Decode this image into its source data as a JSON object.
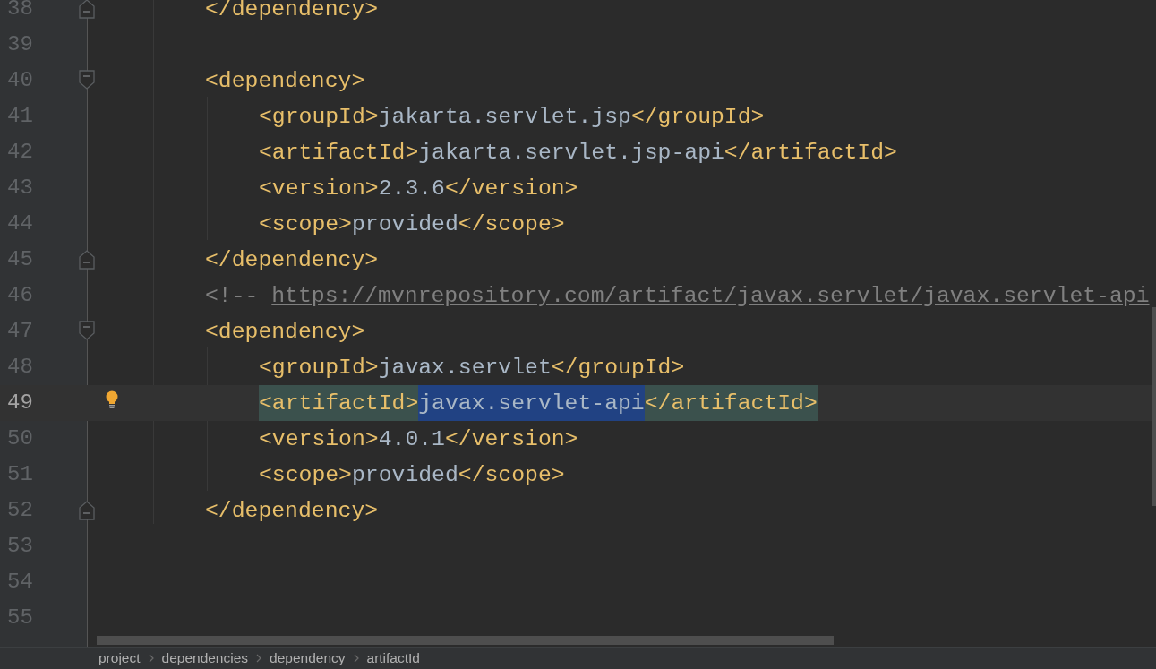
{
  "editor": {
    "lines": [
      {
        "number": "38",
        "current": false,
        "kind": "fold-end",
        "tokens": [
          {
            "kind": "tag",
            "text": "</dependency>"
          }
        ]
      },
      {
        "number": "39",
        "current": false
      },
      {
        "number": "40",
        "current": false,
        "kind": "fold-start",
        "tokens": [
          {
            "kind": "tag",
            "text": "<dependency>"
          }
        ],
        "children": [
          {
            "number": "41",
            "current": false,
            "tokens": [
              {
                "kind": "tag",
                "text": "<groupId>"
              },
              {
                "kind": "value",
                "text": "jakarta.servlet.jsp"
              },
              {
                "kind": "tag",
                "text": "</groupId>"
              }
            ]
          },
          {
            "number": "42",
            "current": false,
            "tokens": [
              {
                "kind": "tag",
                "text": "<artifactId>"
              },
              {
                "kind": "value",
                "text": "jakarta.servlet.jsp-api"
              },
              {
                "kind": "tag",
                "text": "</artifactId>"
              }
            ]
          },
          {
            "number": "43",
            "current": false,
            "tokens": [
              {
                "kind": "tag",
                "text": "<version>"
              },
              {
                "kind": "value",
                "text": "2.3.6"
              },
              {
                "kind": "tag",
                "text": "</version>"
              }
            ]
          },
          {
            "number": "44",
            "current": false,
            "tokens": [
              {
                "kind": "tag",
                "text": "<scope>"
              },
              {
                "kind": "value",
                "text": "provided"
              },
              {
                "kind": "tag",
                "text": "</scope>"
              }
            ]
          }
        ]
      },
      {
        "number": "45",
        "current": false,
        "kind": "fold-end",
        "tokens": [
          {
            "kind": "tag",
            "text": "</dependency>"
          }
        ]
      },
      {
        "number": "46",
        "current": false,
        "tokens": [
          {
            "kind": "comment",
            "text": "<!--"
          },
          {
            "kind": "link",
            "text": "https://mvnrepository.com/artifact/javax.servlet/javax.servlet-api"
          }
        ]
      },
      {
        "number": "47",
        "current": false,
        "kind": "fold-start",
        "tokens": [
          {
            "kind": "tag",
            "text": "<dependency>"
          }
        ],
        "children": [
          {
            "number": "48",
            "current": false,
            "tokens": [
              {
                "kind": "tag",
                "text": "<groupId>"
              },
              {
                "kind": "value",
                "text": "javax.servlet"
              },
              {
                "kind": "tag",
                "text": "</groupId>"
              }
            ]
          },
          {
            "number": "49",
            "current": true,
            "tokens": [
              {
                "kind": "tag-match",
                "text": "<artifactId>"
              },
              {
                "kind": "value-selection",
                "text": "javax.servlet-api"
              },
              {
                "kind": "tag-match",
                "text": "</artifactId>"
              }
            ]
          },
          {
            "number": "50",
            "current": false,
            "tokens": [
              {
                "kind": "tag",
                "text": "<version>"
              },
              {
                "kind": "value",
                "text": "4.0.1"
              },
              {
                "kind": "tag",
                "text": "</version>"
              }
            ]
          },
          {
            "number": "51",
            "current": false,
            "tokens": [
              {
                "kind": "tag",
                "text": "<scope>"
              },
              {
                "kind": "value",
                "text": "provided"
              },
              {
                "kind": "tag",
                "text": "</scope>"
              }
            ]
          }
        ]
      },
      {
        "number": "52",
        "current": false,
        "kind": "fold-end",
        "tokens": [
          {
            "kind": "tag",
            "text": "</dependency>"
          }
        ]
      },
      {
        "number": "53",
        "current": false
      },
      {
        "number": "54",
        "current": false
      },
      {
        "number": "55",
        "current": false
      }
    ]
  },
  "breadcrumbs": [
    "project",
    "dependencies",
    "dependency",
    "artifactId"
  ]
}
